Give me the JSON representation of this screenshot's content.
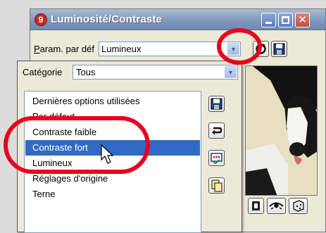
{
  "window": {
    "title": "Luminosité/Contraste",
    "app_icon_glyph": "9"
  },
  "preset": {
    "label_underlined": "P",
    "label_rest": "aram. par déf",
    "value": "Lumineux"
  },
  "category": {
    "label": "Catégorie",
    "value": "Tous"
  },
  "list": {
    "items": [
      "Dernières options utilisées",
      "Par défaut",
      "Contraste faible",
      "Contraste fort",
      "Lumineux",
      "Réglages d'origine",
      "Terne"
    ],
    "selected_index": 3
  },
  "colors": {
    "selection": "#316ac5",
    "annotation": "#e8001c",
    "title_bar": "#7e96bb"
  },
  "icons": {
    "save": "floppy-disk-icon",
    "restore": "undo-arrow-icon",
    "checkbox_list": "checklist-icon",
    "copy": "copy-pages-icon",
    "refresh": "refresh-icon",
    "eye": "eye-icon",
    "dice": "dice-icon"
  }
}
